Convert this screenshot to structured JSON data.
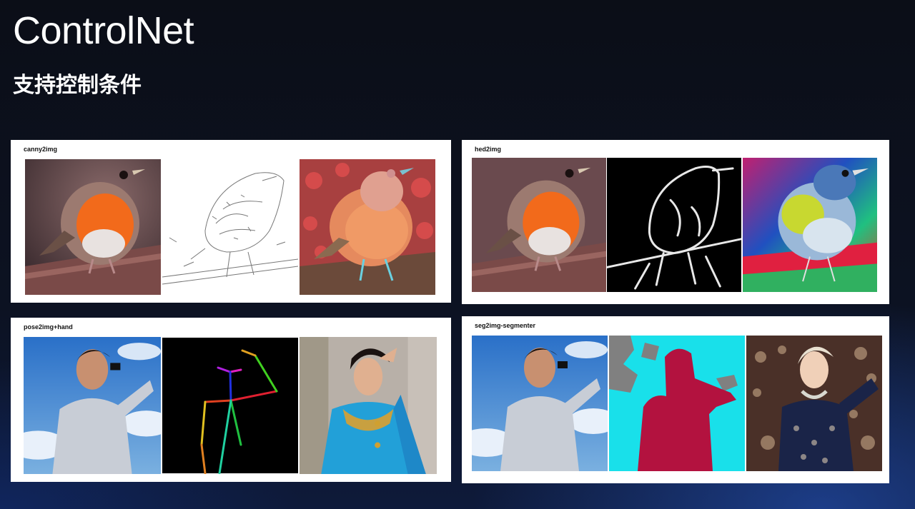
{
  "slide": {
    "title": "ControlNet",
    "subtitle": "支持控制条件"
  },
  "panels": [
    {
      "label": "canny2img"
    },
    {
      "label": "hed2img"
    },
    {
      "label": "pose2img+hand"
    },
    {
      "label": "seg2img-segmenter"
    }
  ],
  "colors": {
    "background": "#0c1222",
    "panel": "#ffffff",
    "robin_breast": "#f26a1b",
    "seg_person": "#b3123f",
    "seg_background": "#19e0ea"
  }
}
